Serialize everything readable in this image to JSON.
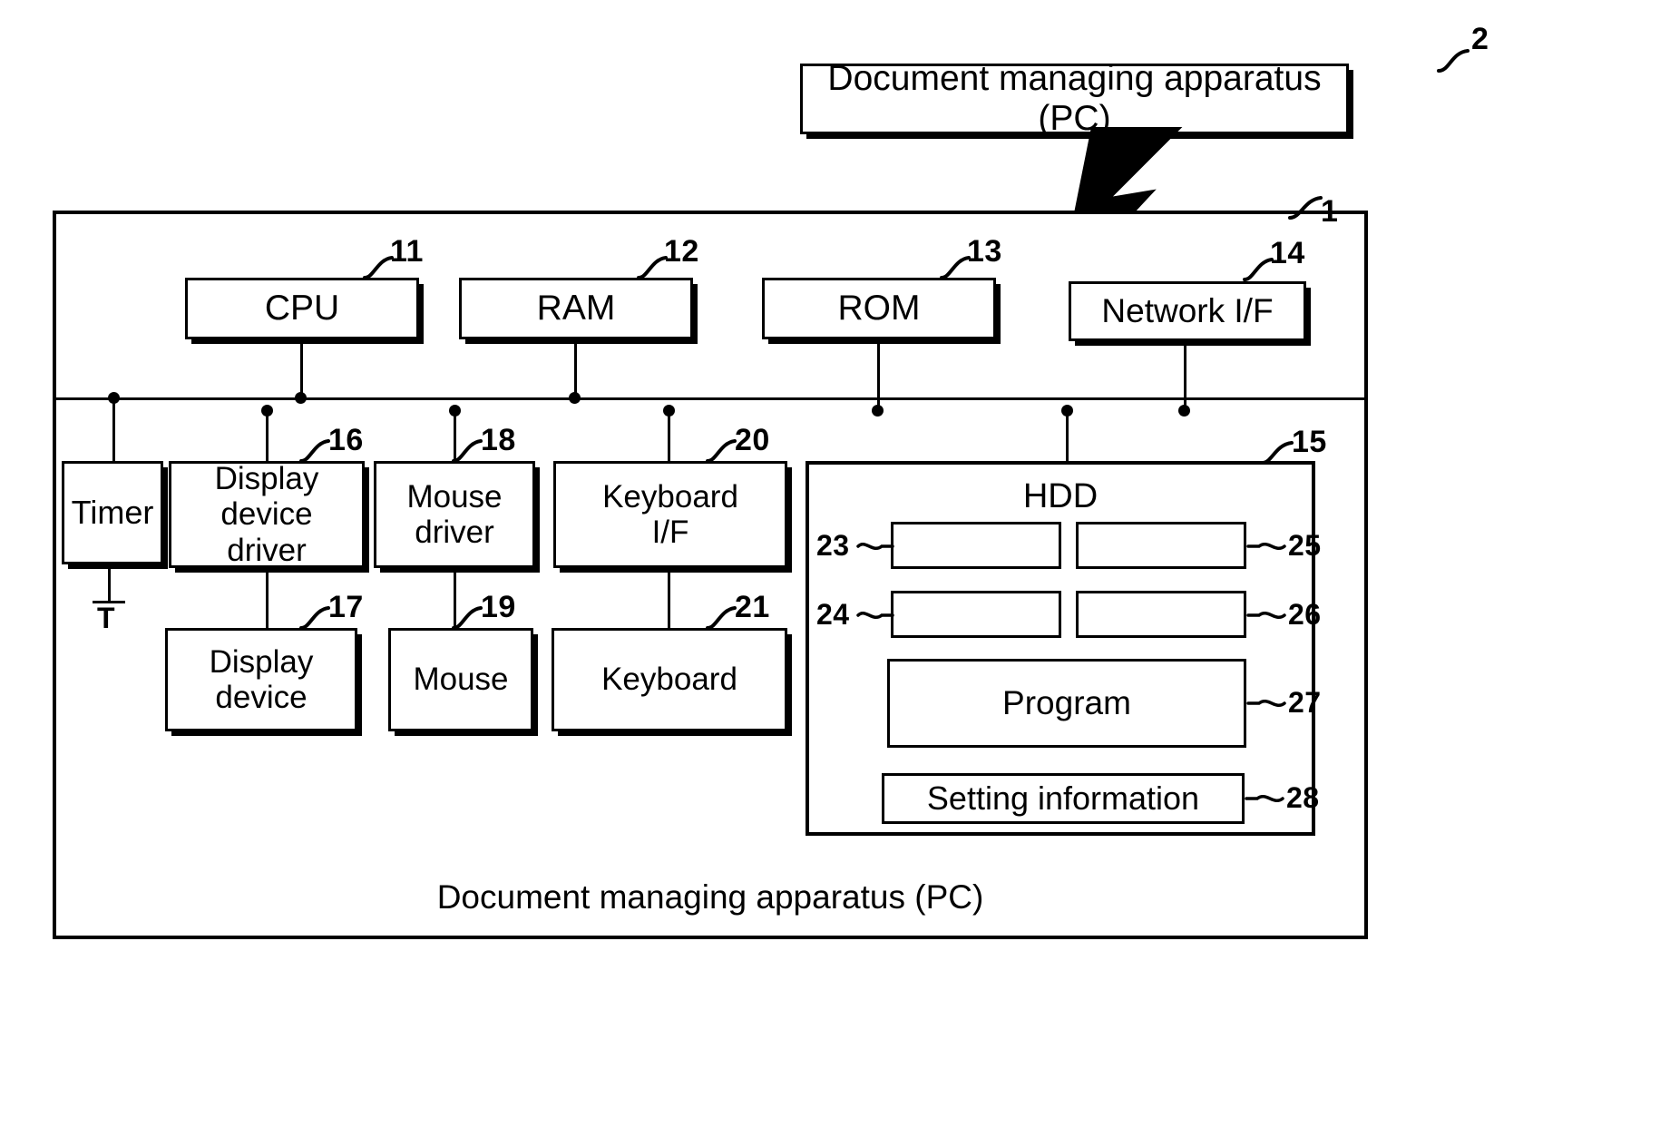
{
  "figure": {
    "callout": {
      "text": "Document managing apparatus (PC)",
      "ref": "2"
    },
    "system": {
      "ref": "1",
      "caption": "Document managing apparatus (PC)"
    },
    "top_row": [
      {
        "label": "CPU",
        "ref": "11"
      },
      {
        "label": "RAM",
        "ref": "12"
      },
      {
        "label": "ROM",
        "ref": "13"
      },
      {
        "label": "Network I/F",
        "ref": "14"
      }
    ],
    "timer": {
      "label": "Timer",
      "signal": "T"
    },
    "mid_row": [
      {
        "label": "Display\ndevice driver",
        "ref": "16"
      },
      {
        "label": "Mouse\ndriver",
        "ref": "18"
      },
      {
        "label": "Keyboard\nI/F",
        "ref": "20"
      }
    ],
    "bottom_row": [
      {
        "label": "Display\ndevice",
        "ref": "17"
      },
      {
        "label": "Mouse",
        "ref": "19"
      },
      {
        "label": "Keyboard",
        "ref": "21"
      }
    ],
    "hdd": {
      "title": "HDD",
      "ref": "15",
      "slots": [
        {
          "label": "",
          "ref": "23"
        },
        {
          "label": "",
          "ref": "25"
        },
        {
          "label": "",
          "ref": "24"
        },
        {
          "label": "",
          "ref": "26"
        }
      ],
      "program": {
        "label": "Program",
        "ref": "27"
      },
      "settings": {
        "label": "Setting information",
        "ref": "28"
      }
    },
    "colors": {
      "ink": "#000000",
      "paper": "#ffffff"
    }
  }
}
